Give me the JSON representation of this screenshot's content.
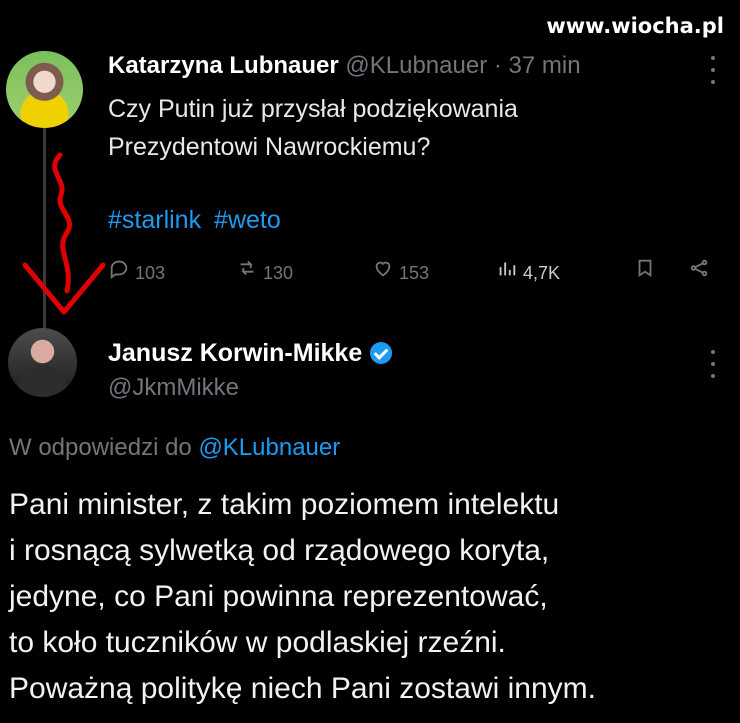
{
  "watermark": "www.wiocha.pl",
  "tweet1": {
    "author": {
      "name": "Katarzyna Lubnauer",
      "handle": "@KLubnauer",
      "time": "37 min"
    },
    "text": {
      "line1": "Czy Putin już przysłał podziękowania",
      "line2": "Prezydentowi Nawrockiemu?"
    },
    "hashtags": [
      "#starlink",
      "#weto"
    ],
    "stats": {
      "replies": "103",
      "reposts": "130",
      "likes": "153",
      "views": "4,7K"
    }
  },
  "tweet2": {
    "author": {
      "name": "Janusz Korwin-Mikke",
      "handle": "@JkmMikke"
    },
    "reply_to": {
      "prefix": "W odpowiedzi do",
      "handle": "@KLubnauer"
    },
    "body": [
      "Pani minister, z takim poziomem intelektu",
      "i rosnącą sylwetką od rządowego koryta,",
      "jedyne, co Pani powinna reprezentować,",
      "to koło tuczników w podlaskiej rzeźni.",
      "Poważną politykę niech Pani zostawi innym."
    ]
  },
  "colors": {
    "background": "#000000",
    "text": "#e7e9ea",
    "muted": "#71767b",
    "link": "#1d9bf0",
    "annotation": "#e00000"
  },
  "icons": {
    "reply": "reply-icon",
    "repost": "repost-icon",
    "like": "heart-icon",
    "views": "analytics-icon",
    "bookmark": "bookmark-icon",
    "share": "share-icon",
    "more": "more-icon",
    "verified": "verified-badge-icon"
  }
}
